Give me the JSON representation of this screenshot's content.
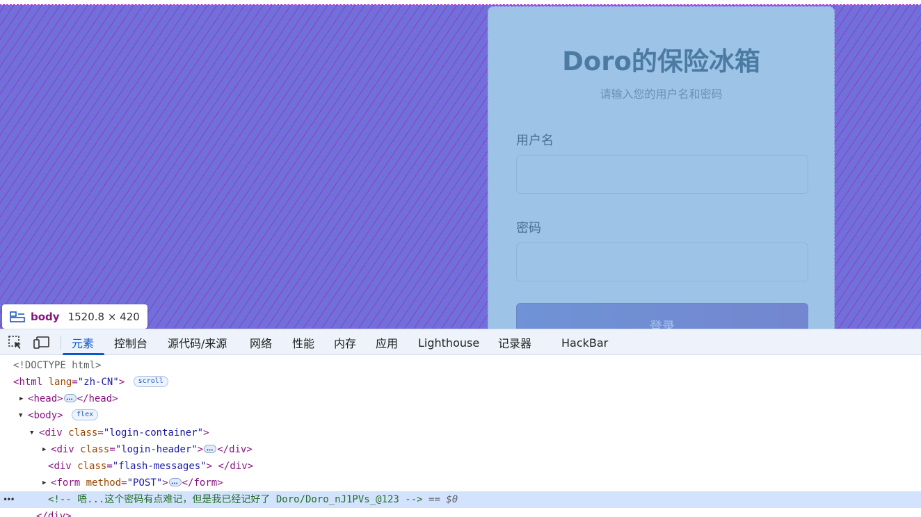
{
  "page": {
    "card": {
      "title": "Doro的保险冰箱",
      "subtitle": "请输入您的用户名和密码",
      "username_label": "用户名",
      "password_label": "密码",
      "login_button": "登录"
    },
    "inspect_tooltip": {
      "tag": "body",
      "size": "1520.8 × 420"
    }
  },
  "devtools": {
    "tabs": [
      {
        "label": "元素",
        "active": true
      },
      {
        "label": "控制台"
      },
      {
        "label": "源代码/来源"
      },
      {
        "label": "网络"
      },
      {
        "label": "性能"
      },
      {
        "label": "内存"
      },
      {
        "label": "应用"
      },
      {
        "label": "Lighthouse"
      },
      {
        "label": "记录器"
      },
      {
        "label": "HackBar"
      }
    ],
    "tree": {
      "doctype": "<!DOCTYPE html>",
      "html_tag": "html",
      "html_attr": "lang",
      "html_val": "\"zh-CN\"",
      "scroll_badge": "scroll",
      "head_tag": "head",
      "body_tag": "body",
      "flex_badge": "flex",
      "div_tag": "div",
      "class_attr": "class",
      "login_container": "\"login-container\"",
      "login_header": "\"login-header\"",
      "flash_messages": "\"flash-messages\"",
      "form_tag": "form",
      "method_attr": "method",
      "method_val": "\"POST\"",
      "comment": "<!-- 唔...这个密码有点难记，但是我已经记好了 Doro/Doro_nJ1PVs_@123 -->",
      "selected_marker": "== $0",
      "closing_div": "</div>"
    }
  },
  "colors": {
    "page_background": "#7170d8",
    "card_background": "#9dc4e7",
    "title_color": "#4b7aa3",
    "devtools_accent": "#0b57d0",
    "selected_row": "#d3e3fd"
  }
}
